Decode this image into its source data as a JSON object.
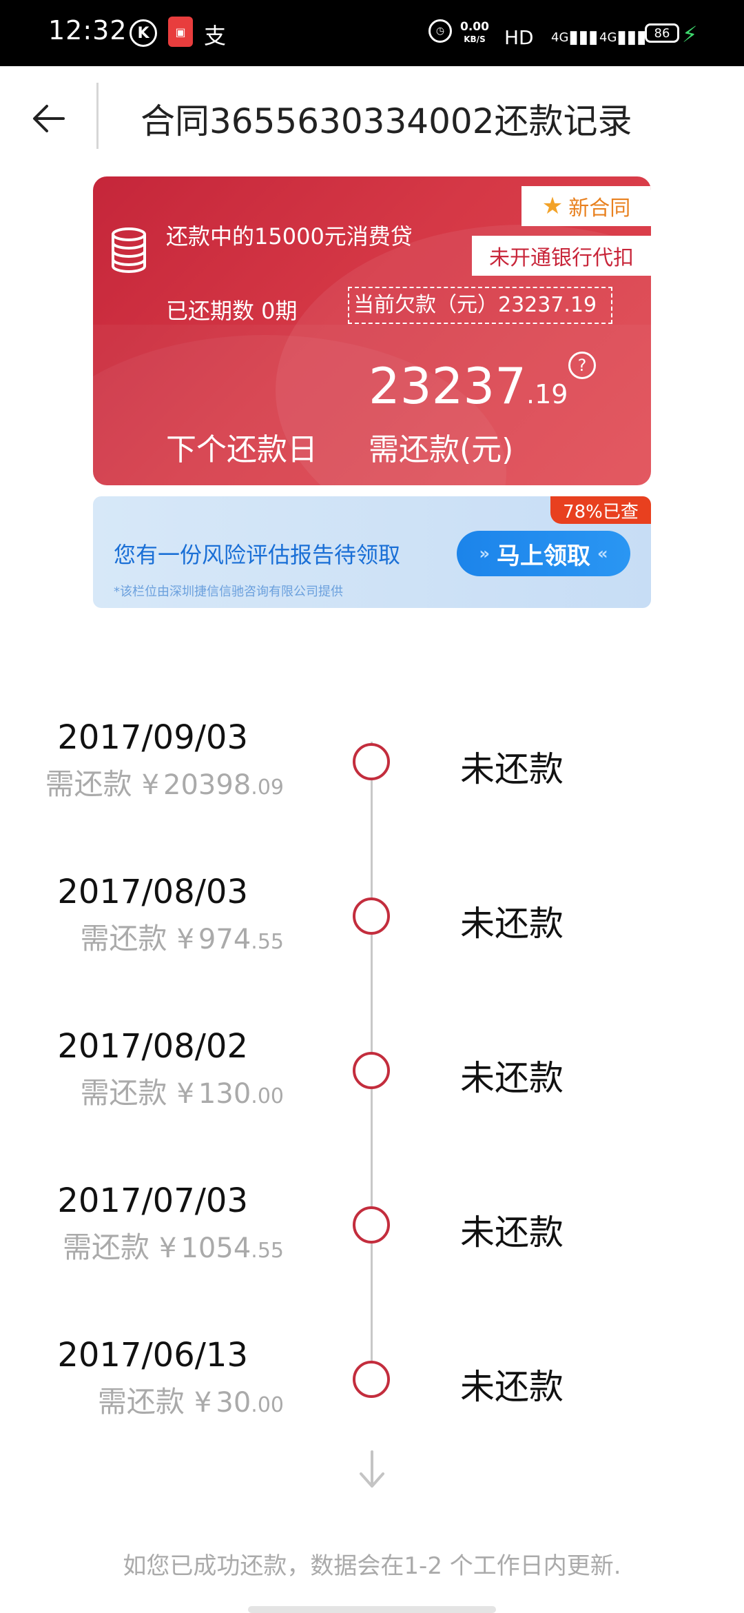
{
  "status_bar": {
    "time": "12:32",
    "k_icon": "K",
    "zhi_icon": "支",
    "speed_value": "0.00",
    "speed_unit": "KB/S",
    "hd": "HD",
    "signal1": "4G",
    "signal2": "4G",
    "battery": "86"
  },
  "header": {
    "title": "合同3655630334002还款记录"
  },
  "loan_card": {
    "title": "还款中的15000元消费贷",
    "periods_paid": "已还期数 0期",
    "current_debt": "当前欠款（元）23237.19",
    "tag_new": "新合同",
    "tag_bank": "未开通银行代扣",
    "amount_int": "23237",
    "amount_dec": ".19",
    "help": "?",
    "next_day_label": "下个还款日",
    "need_pay_label": "需还款(元)"
  },
  "banner": {
    "tag": "78%已查",
    "text": "您有一份风险评估报告待领取",
    "sub": "*该栏位由深圳捷信信驰咨询有限公司提供",
    "button": "马上领取"
  },
  "timeline": [
    {
      "date": "2017/09/03",
      "label": "需还款",
      "yen": "¥",
      "amount_int": "20398",
      "amount_dec": ".09",
      "status": "未还款"
    },
    {
      "date": "2017/08/03",
      "label": "需还款",
      "yen": "¥",
      "amount_int": "974",
      "amount_dec": ".55",
      "status": "未还款"
    },
    {
      "date": "2017/08/02",
      "label": "需还款",
      "yen": "¥",
      "amount_int": "130",
      "amount_dec": ".00",
      "status": "未还款"
    },
    {
      "date": "2017/07/03",
      "label": "需还款",
      "yen": "¥",
      "amount_int": "1054",
      "amount_dec": ".55",
      "status": "未还款"
    },
    {
      "date": "2017/06/13",
      "label": "需还款",
      "yen": "¥",
      "amount_int": "30",
      "amount_dec": ".00",
      "status": "未还款"
    }
  ],
  "footer": {
    "note": "如您已成功还款，数据会在1-2 个工作日内更新."
  },
  "colors": {
    "brand_red": "#c5263a",
    "banner_blue": "#1a6fd6",
    "status_green": "#3ed86d"
  }
}
